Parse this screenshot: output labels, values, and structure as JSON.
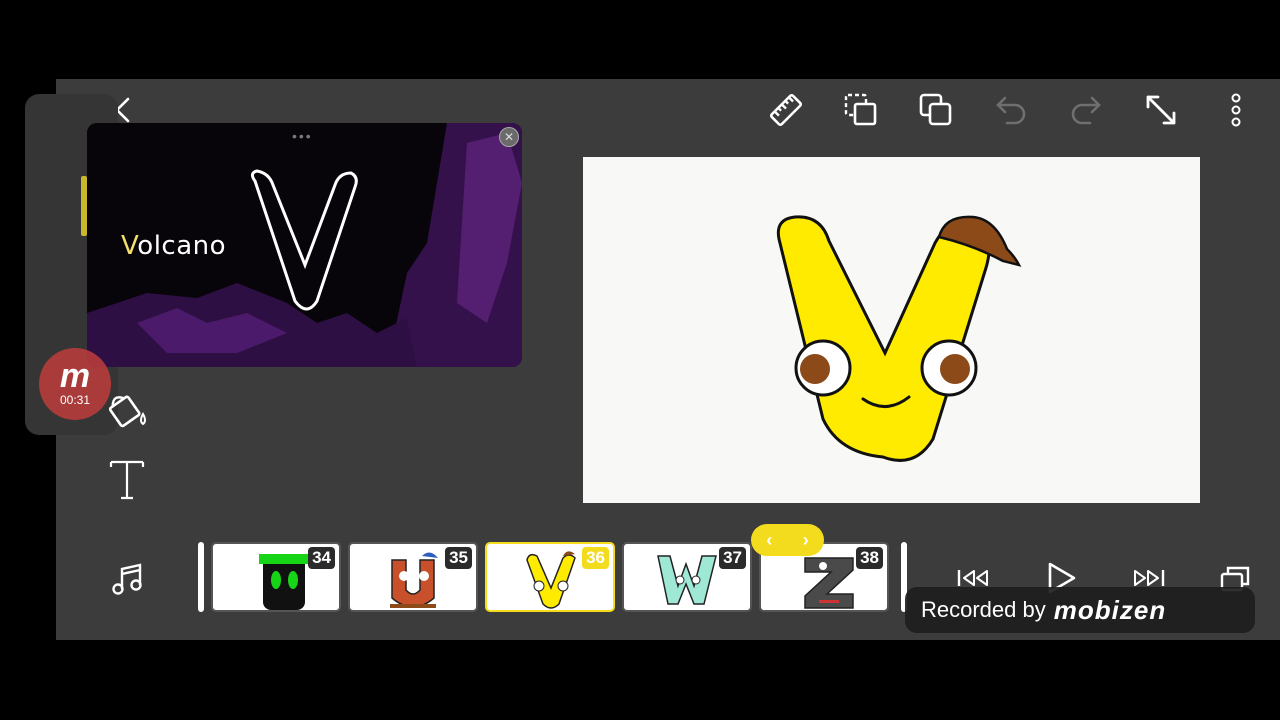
{
  "toolbar": {
    "icons": [
      "back-icon",
      "ruler-icon",
      "copy-frame-icon",
      "duplicate-icon",
      "undo-icon",
      "redo-icon",
      "expand-icon",
      "more-icon"
    ]
  },
  "reference": {
    "first_letter": "V",
    "rest": "olcano"
  },
  "recording": {
    "logo": "m",
    "time": "00:31"
  },
  "timeline": {
    "frames": [
      {
        "number": "34"
      },
      {
        "number": "35"
      },
      {
        "number": "36",
        "active": true
      },
      {
        "number": "37"
      },
      {
        "number": "38"
      }
    ],
    "scroll_left": "‹",
    "scroll_right": "›"
  },
  "playback": {
    "icons": [
      "skip-back-icon",
      "play-icon",
      "skip-forward-icon",
      "layers-icon"
    ]
  },
  "watermark": {
    "label": "Recorded by",
    "brand": "mobizen"
  },
  "colors": {
    "accent": "#f3dc1e",
    "app_bg": "#3c3c3c",
    "letter_yellow": "#ffeb00",
    "hat_brown": "#8b4a18"
  }
}
